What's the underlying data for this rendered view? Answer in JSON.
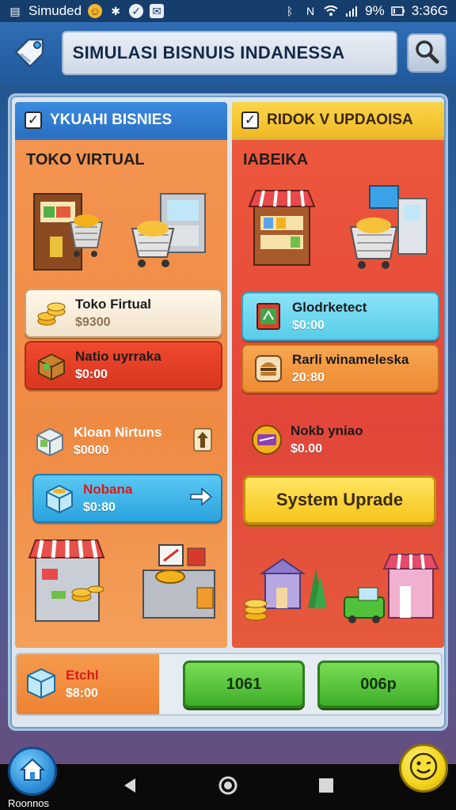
{
  "status_bar": {
    "app_name": "Simuded",
    "battery": "9%",
    "time": "3:36G"
  },
  "header": {
    "title": "SIMULASI BISNUIS INDANESSA"
  },
  "left_panel": {
    "tab_label": "YKUAHI BISNIES",
    "section_title": "TOKO VIRTUAL",
    "items": [
      {
        "name": "Toko Firtual",
        "price": "$9300"
      },
      {
        "name": "Natio uyrraka",
        "price": "$0:00"
      },
      {
        "name": "Kloan Nirtuns",
        "price": "$0000"
      },
      {
        "name": "Nobana",
        "price": "$0:80"
      }
    ]
  },
  "right_panel": {
    "tab_label": "RIDOK V UPDAOISA",
    "section_title": "IABEIKA",
    "items": [
      {
        "name": "Glodrketect",
        "price": "$0:00"
      },
      {
        "name": "Rarli winameleska",
        "price": "20:80"
      },
      {
        "name": "Nokb yniao",
        "price": "$0.00"
      }
    ],
    "upgrade_button": "System Uprade"
  },
  "bottom_bar": {
    "stat_name": "Etchl",
    "stat_value": "$8:00",
    "button_1": "1061",
    "button_2": "006p"
  },
  "nav": {
    "home_label": "Roonnos"
  },
  "colors": {
    "left_tab": "#2a6fc0",
    "right_tab": "#f0b924",
    "left_panel": "#ef8a43",
    "right_panel": "#e2463a",
    "upgrade_button": "#f5c51a",
    "green_button": "#3fae2a"
  }
}
